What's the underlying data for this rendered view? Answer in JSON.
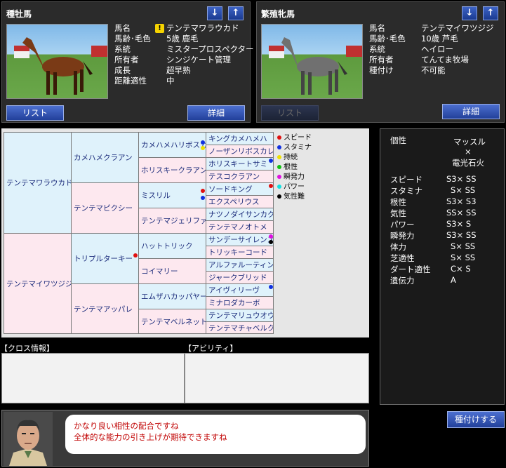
{
  "sire_panel": {
    "title": "種牡馬",
    "rows": [
      {
        "label": "馬名",
        "value": "テンテマワラウカド"
      },
      {
        "label": "馬齢･毛色",
        "value": "5歳 鹿毛"
      },
      {
        "label": "系統",
        "value": "ミスタープロスペクター"
      },
      {
        "label": "所有者",
        "value": "シンジケート管理"
      },
      {
        "label": "成長",
        "value": "超早熟"
      },
      {
        "label": "距離適性",
        "value": "中"
      }
    ],
    "list_button": "リスト",
    "detail_button": "詳細"
  },
  "dam_panel": {
    "title": "繁殖牝馬",
    "rows": [
      {
        "label": "馬名",
        "value": "テンテマイワツジジ"
      },
      {
        "label": "馬齢･毛色",
        "value": "10歳 芦毛"
      },
      {
        "label": "系統",
        "value": "ヘイロー"
      },
      {
        "label": "所有者",
        "value": "てんてま牧場"
      },
      {
        "label": "種付け",
        "value": "不可能"
      }
    ],
    "list_button": "リスト",
    "detail_button": "詳細"
  },
  "pedigree": {
    "gen1": [
      "テンテマワラウカド",
      "テンテマイワツジジ"
    ],
    "gen2": [
      "カメハメクラアン",
      "テンテマピクシー",
      "トリプルターキー",
      "テンテマアッパレ"
    ],
    "gen3": [
      "カメハメハリボスカ",
      "ホリスキークラアン",
      "ミスリル",
      "テンテマジェリファ",
      "ハットトリック",
      "コイマリー",
      "エムザハカッパヤー",
      "テンテマベルネット"
    ],
    "gen4": [
      "キングカメハメハ",
      "ノーザンリボスカレ",
      "ホリスキートサミ",
      "テスコクラアン",
      "ソードキング",
      "エクスペリウス",
      "ナツノダイサンカク",
      "テンテマノオトメ",
      "サンデーサイレンス",
      "トリッキーコード",
      "アルファルーティン",
      "ジャークブリッド",
      "アイヴィリーヴ",
      "ミナロダカーボ",
      "テンテマリュウオウ",
      "テンテマチャベルク"
    ]
  },
  "legend": [
    {
      "label": "スピード",
      "color": "#e01010"
    },
    {
      "label": "スタミナ",
      "color": "#1030e0"
    },
    {
      "label": "持続",
      "color": "#f0e000"
    },
    {
      "label": "根性",
      "color": "#10c010"
    },
    {
      "label": "瞬発力",
      "color": "#e010e0"
    },
    {
      "label": "パワー",
      "color": "#10e0e0"
    },
    {
      "label": "気性難",
      "color": "#000000"
    }
  ],
  "stats": {
    "personality_label": "個性",
    "personality_line1": "マッスル",
    "personality_line2": "×",
    "personality_line3": "電光石火",
    "rows": [
      {
        "label": "スピード",
        "value": "S3× SS"
      },
      {
        "label": "スタミナ",
        "value": "S× SS"
      },
      {
        "label": "根性",
        "value": "S3× S3"
      },
      {
        "label": "気性",
        "value": "SS× SS"
      },
      {
        "label": "パワー",
        "value": "S3×  S"
      },
      {
        "label": "瞬発力",
        "value": "S3× SS"
      },
      {
        "label": "体力",
        "value": "S× SS"
      },
      {
        "label": "芝適性",
        "value": "S× SS"
      },
      {
        "label": "ダート適性",
        "value": "C×  S"
      },
      {
        "label": "遺伝力",
        "value": "A"
      }
    ]
  },
  "cross_title": "【クロス情報】",
  "ability_title": "【アビリティ】",
  "dialog": {
    "line1": "かなり良い相性の配合ですね",
    "line2": "全体的な能力の引き上げが期待できますね"
  },
  "breed_button": "種付けする",
  "warning_mark": "!",
  "down_arrow": "↓",
  "up_arrow": "↑"
}
